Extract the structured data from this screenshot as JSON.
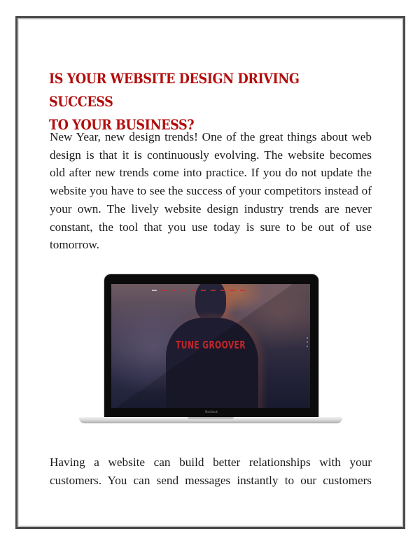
{
  "document": {
    "title_line1": "Is Your Website Design Driving Success",
    "title_line2": "to Your Business?",
    "paragraph1": "New Year, new design trends! One of the great things about web design is that it is continuously evolving. The website becomes old after new trends come into practice. If you do not update the website you have to see the success of your competitors instead of your own. The lively website design industry trends are never constant, the tool that you use today is sure to be out of use tomorrow.",
    "paragraph2": "Having a website can build better relationships with your customers. You can send messages instantly to our customers",
    "title_color": "#b30d0d"
  },
  "illustration": {
    "device": "laptop",
    "screen_brand_text": "TUNE GROOVER",
    "device_label": "MacBook",
    "brand_color": "#c0262a"
  }
}
